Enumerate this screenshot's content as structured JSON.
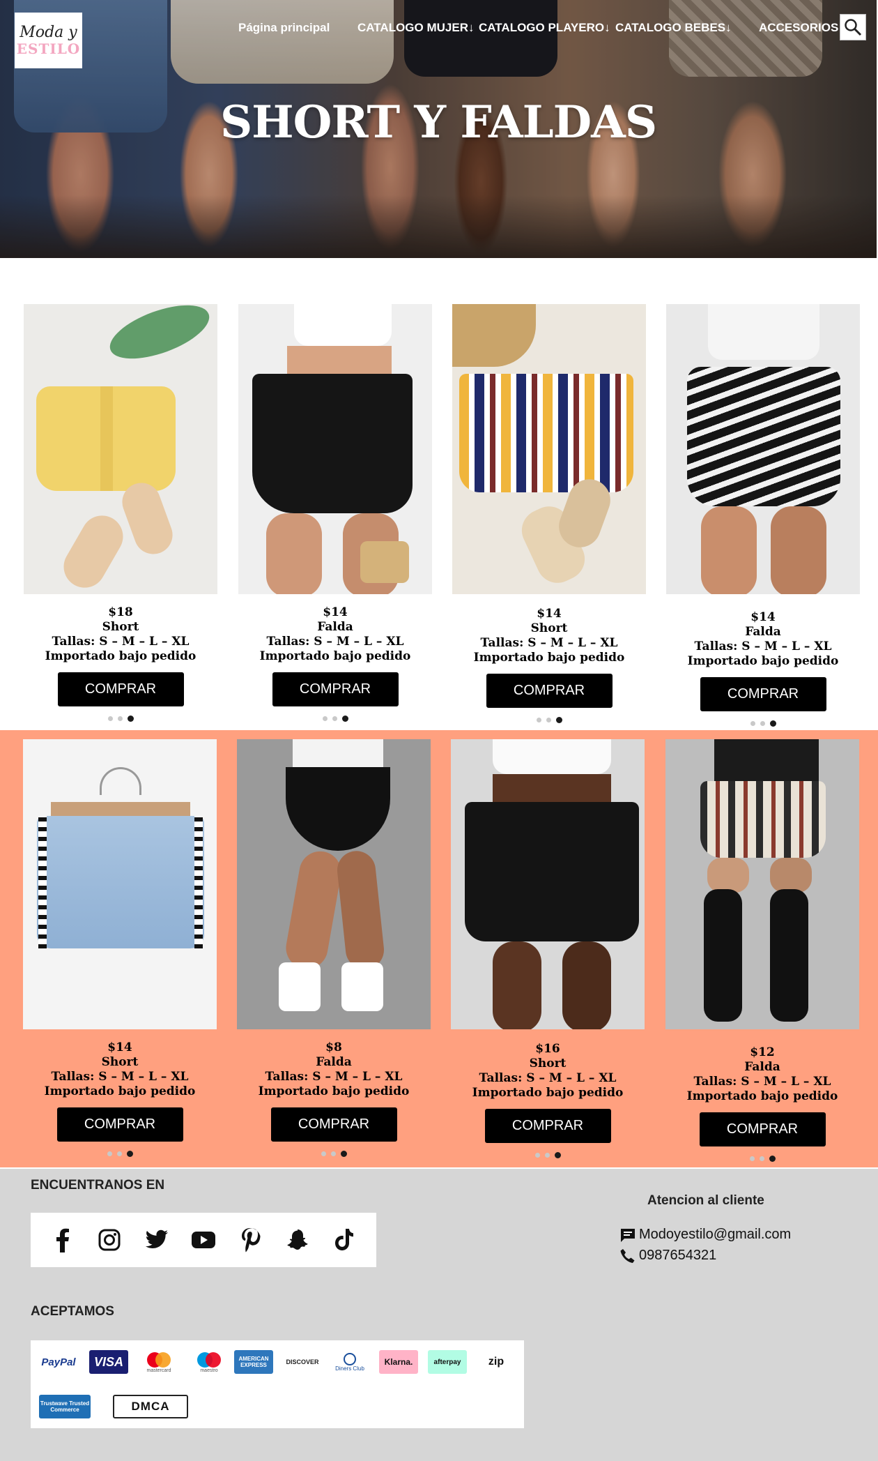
{
  "logo": {
    "line1": "Moda y",
    "line2": "ESTILO"
  },
  "nav": {
    "home": "Página principal",
    "women": "CATALOGO MUJER↓",
    "beach": "CATALOGO PLAYERO↓",
    "babies": "CATALOGO BEBES↓",
    "accessories": "ACCESORIOS↓"
  },
  "icons": {
    "search": "search-icon"
  },
  "hero": {
    "title": "SHORT Y FALDAS"
  },
  "products": [
    {
      "price": "$18",
      "type": "Short",
      "sizes": "Tallas: S – M – L – XL",
      "note": "Importado bajo pedido",
      "button": "COMPRAR",
      "dots_total": 3,
      "active_dot": 3
    },
    {
      "price": "$14",
      "type": "Falda",
      "sizes": "Tallas: S – M – L – XL",
      "note": "Importado bajo pedido",
      "button": "COMPRAR",
      "dots_total": 3,
      "active_dot": 3
    },
    {
      "price": "$14",
      "type": "Short",
      "sizes": "Tallas: S – M – L – XL",
      "note": "Importado bajo pedido",
      "button": "COMPRAR",
      "dots_total": 3,
      "active_dot": 3
    },
    {
      "price": "$14",
      "type": "Falda",
      "sizes": "Tallas: S – M – L – XL",
      "note": "Importado bajo pedido",
      "button": "COMPRAR",
      "dots_total": 3,
      "active_dot": 3
    },
    {
      "price": "$14",
      "type": "Short",
      "sizes": "Tallas: S – M – L – XL",
      "note": "Importado bajo pedido",
      "button": "COMPRAR",
      "dots_total": 3,
      "active_dot": 3
    },
    {
      "price": "$8",
      "type": "Falda",
      "sizes": "Tallas: S – M – L – XL",
      "note": "Importado bajo pedido",
      "button": "COMPRAR",
      "dots_total": 3,
      "active_dot": 3
    },
    {
      "price": "$16",
      "type": "Short",
      "sizes": "Tallas: S – M – L – XL",
      "note": "Importado bajo pedido",
      "button": "COMPRAR",
      "dots_total": 3,
      "active_dot": 3
    },
    {
      "price": "$12",
      "type": "Falda",
      "sizes": "Tallas: S – M – L – XL",
      "note": "Importado bajo pedido",
      "button": "COMPRAR",
      "dots_total": 3,
      "active_dot": 3
    }
  ],
  "footer": {
    "find_us": "ENCUENTRANOS EN",
    "social_icons": [
      "facebook-icon",
      "instagram-icon",
      "twitter-icon",
      "youtube-icon",
      "pinterest-icon",
      "snapchat-icon",
      "tiktok-icon"
    ],
    "accept": "ACEPTAMOS",
    "payment_methods": [
      "PayPal",
      "VISA",
      "mastercard",
      "maestro",
      "AMERICAN EXPRESS",
      "DISCOVER",
      "Diners Club",
      "Klarna.",
      "afterpay",
      "zip",
      "Trustwave Trusted Commerce",
      "DMCA"
    ],
    "support_title": "Atencion al cliente",
    "email": "Modoyestilo@gmail.com",
    "phone": "0987654321"
  },
  "colors": {
    "band": "#ffa07f",
    "footer": "#d6d6d6",
    "button": "#000000",
    "logo_pink": "#f3a6c0"
  }
}
